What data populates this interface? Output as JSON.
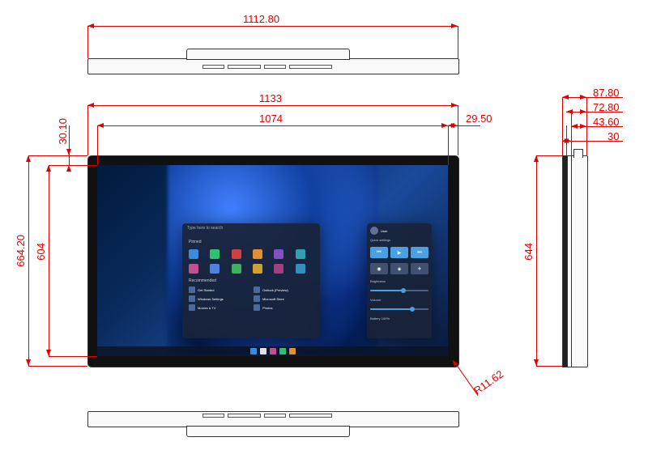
{
  "dimensions": {
    "top_overall_width": "1112.80",
    "front_width_outer": "1133",
    "front_width_inner": "1074",
    "front_bezel_right": "29.50",
    "front_bezel_top": "30.10",
    "front_height_outer": "664.20",
    "front_height_inner": "604",
    "side_height": "644",
    "side_depth_1": "87.80",
    "side_depth_2": "72.80",
    "side_depth_3": "43.60",
    "side_depth_4": "30",
    "corner_radius": "R11.62"
  },
  "os_ui": {
    "start_menu_header": "Type here to search",
    "pinned_label": "Pinned",
    "recommended_label": "Recommended",
    "recommended_items": [
      "Get Started",
      "Outlook (Preview)",
      "Windows Settings",
      "Microsoft Store",
      "Movies & TV",
      "Photos"
    ],
    "user_label": "User",
    "quick_settings_title": "Quick settings",
    "battery_label": "Battery 100%",
    "brightness_label": "Brightness",
    "volume_label": "Volume"
  },
  "icon_colors": [
    "#3a8ae0",
    "#30c070",
    "#d04040",
    "#e09030",
    "#8050c0",
    "#30a0b0",
    "#c05090",
    "#5080e0",
    "#40b060",
    "#d0a030",
    "#a04080",
    "#3090c0"
  ],
  "taskbar_colors": [
    "#3a8ae0",
    "#e0e0e0",
    "#c05090",
    "#30c070",
    "#e09030"
  ]
}
